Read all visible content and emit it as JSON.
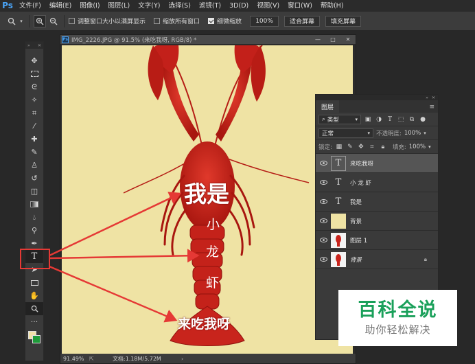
{
  "menubar": {
    "logo": "Ps",
    "items": [
      "文件(F)",
      "编辑(E)",
      "图像(I)",
      "图层(L)",
      "文字(Y)",
      "选择(S)",
      "滤镜(T)",
      "3D(D)",
      "视图(V)",
      "窗口(W)",
      "帮助(H)"
    ]
  },
  "options": {
    "resize_windows": "调整窗口大小以满屏显示",
    "zoom_all": "缩放所有窗口",
    "scrubby_zoom": "细微缩放",
    "zoom_value": "100%",
    "fit_screen": "适合屏幕",
    "fill_screen": "填充屏幕"
  },
  "document": {
    "tab_title": "IMG_2226.JPG @ 91.5% (来吃我呀, RGB/8) *",
    "canvas_text": {
      "line1": "我是",
      "line2_a": "小",
      "line2_b": "龙",
      "line2_c": "虾",
      "line3": "来吃我呀"
    },
    "zoom": "91.49%",
    "doc_size": "文档:1.18M/5.72M"
  },
  "layers_panel": {
    "tab": "图层",
    "filter_kind": "类型",
    "blend_mode": "正常",
    "opacity_label": "不透明度:",
    "opacity_value": "100%",
    "lock_label": "锁定:",
    "fill_label": "填充:",
    "fill_value": "100%",
    "layers": [
      {
        "name": "来吃我呀",
        "kind": "text"
      },
      {
        "name": "小 龙 虾",
        "kind": "text"
      },
      {
        "name": "我是",
        "kind": "text"
      },
      {
        "name": "背景",
        "kind": "fill"
      },
      {
        "name": "图层 1",
        "kind": "image"
      },
      {
        "name": "背景",
        "kind": "image-locked"
      }
    ]
  },
  "watermark": {
    "big": "百科全说",
    "small": "助你轻松解决"
  },
  "colors": {
    "accent_red": "#e53935",
    "canvas_bg": "#efe3a4",
    "lobster": "#c8241c",
    "watermark_green": "#1aa05a"
  }
}
